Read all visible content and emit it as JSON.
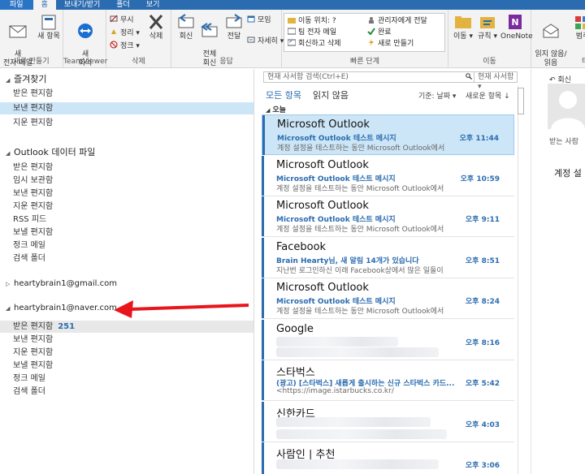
{
  "ribbon": {
    "tabs": [
      {
        "label": "파일"
      },
      {
        "label": "홈"
      },
      {
        "label": "보내기/받기"
      },
      {
        "label": "폴더"
      },
      {
        "label": "보기"
      }
    ],
    "groups": {
      "new": {
        "label": "새로 만들기",
        "new_email": "새\n전자 메일",
        "new_items": "새 항목"
      },
      "teamviewer": {
        "label": "TeamViewer",
        "new_meeting": "새\n회의"
      },
      "delete": {
        "label": "삭제",
        "ignore": "무시",
        "cleanup": "정리",
        "junk": "정크",
        "delete": "삭제"
      },
      "respond": {
        "label": "응답",
        "reply": "회신",
        "reply_all": "전체\n회신",
        "forward": "전달",
        "meeting": "모임",
        "more": "자세히"
      },
      "quick_steps": {
        "label": "빠른 단계",
        "items": [
          "이동 위치: ?",
          "팀 전자 메일",
          "회신하고 삭제",
          "관리자에게 전달",
          "완료",
          "새로 만들기"
        ]
      },
      "move": {
        "label": "이동",
        "move": "이동",
        "rules": "규칙",
        "onenote": "OneNote"
      },
      "tags": {
        "label": "태그",
        "read_unread": "읽지 않음/\n읽음",
        "categorize": "범주"
      }
    }
  },
  "folders": {
    "favorites": {
      "title": "즐겨찾기",
      "items": [
        {
          "label": "받은 편지함"
        },
        {
          "label": "보낸 편지함"
        },
        {
          "label": "지운 편지함"
        }
      ]
    },
    "outlook_data": {
      "title": "Outlook 데이터 파일",
      "items": [
        {
          "label": "받은 편지함"
        },
        {
          "label": "임시 보관함"
        },
        {
          "label": "보낸 편지함"
        },
        {
          "label": "지운 편지함"
        },
        {
          "label": "RSS 피드"
        },
        {
          "label": "보낼 편지함"
        },
        {
          "label": "정크 메일"
        },
        {
          "label": "검색 폴더"
        }
      ]
    },
    "gmail": {
      "title": "heartybrain1@gmail.com"
    },
    "naver": {
      "title": "heartybrain1@naver.com",
      "items": [
        {
          "label": "받은 편지함",
          "count": "251"
        },
        {
          "label": "보낸 편지함"
        },
        {
          "label": "지운 편지함"
        },
        {
          "label": "보낼 편지함"
        },
        {
          "label": "정크 메일"
        },
        {
          "label": "검색 폴더"
        }
      ]
    }
  },
  "list": {
    "search_placeholder": "현재 사서함 검색(Ctrl+E)",
    "search_scope": "현재 사서함",
    "filter_all": "모든 항목",
    "filter_unread": "읽지 않음",
    "sort_by": "기준: 날짜",
    "sort_order": "새로운 항목",
    "group_today": "오늘",
    "messages": [
      {
        "sender": "Microsoft Outlook",
        "subject": "Microsoft Outlook 테스트 메시지",
        "preview": "계정 설정을 테스트하는 동안 Microsoft Outlook에서",
        "time": "오후 11:44"
      },
      {
        "sender": "Microsoft Outlook",
        "subject": "Microsoft Outlook 테스트 메시지",
        "preview": "계정 설정을 테스트하는 동안 Microsoft Outlook에서",
        "time": "오후 10:59"
      },
      {
        "sender": "Microsoft Outlook",
        "subject": "Microsoft Outlook 테스트 메시지",
        "preview": "계정 설정을 테스트하는 동안 Microsoft Outlook에서",
        "time": "오후 9:11"
      },
      {
        "sender": "Facebook",
        "subject": "Brain Hearty님, 새 알림 14개가 있습니다",
        "preview": "지난번 로그인하신 이래 Facebook상에서 많은 일들이",
        "time": "오후 8:51"
      },
      {
        "sender": "Microsoft Outlook",
        "subject": "Microsoft Outlook 테스트 메시지",
        "preview": "계정 설정을 테스트하는 동안 Microsoft Outlook에서",
        "time": "오후 8:24"
      },
      {
        "sender": "Google",
        "subject": "",
        "preview": "",
        "time": "오후 8:16"
      },
      {
        "sender": "스타벅스",
        "subject": "(광고) [스타벅스] 새롭게 출시하는 신규 스타벅스 카드...",
        "preview": "<https://image.istarbucks.co.kr/",
        "time": "오후 5:42"
      },
      {
        "sender": "신한카드",
        "subject": "",
        "preview": "",
        "time": "오후 4:03"
      },
      {
        "sender": "사람인 | 추천",
        "subject": "",
        "preview": "",
        "time": "오후 3:06"
      }
    ]
  },
  "reading": {
    "reply": "회신",
    "recipient": "받는 사람",
    "body": "계정 설"
  },
  "colors": {
    "accent": "#2b6cb0",
    "selection": "#cde6f7",
    "annotation_arrow": "#e8151b"
  }
}
